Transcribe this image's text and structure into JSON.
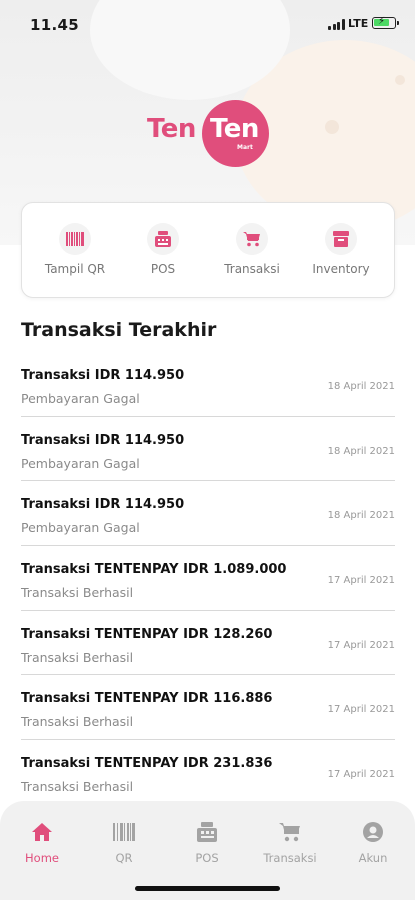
{
  "status_bar": {
    "time": "11.45",
    "network": "LTE",
    "battery_level": 0.7
  },
  "brand": {
    "word1": "Ten",
    "word2": "Ten",
    "sub": "Mart",
    "color": "#e04e7c"
  },
  "menu": [
    {
      "label": "Tampil QR",
      "icon": "barcode-icon"
    },
    {
      "label": "POS",
      "icon": "cash-register-icon"
    },
    {
      "label": "Transaksi",
      "icon": "cart-icon"
    },
    {
      "label": "Inventory",
      "icon": "box-icon"
    }
  ],
  "section_title": "Transaksi Terakhir",
  "transactions": [
    {
      "title": "Transaksi  IDR 114.950",
      "status": "Pembayaran Gagal",
      "date": "18 April 2021"
    },
    {
      "title": "Transaksi  IDR 114.950",
      "status": "Pembayaran Gagal",
      "date": "18 April 2021"
    },
    {
      "title": "Transaksi  IDR 114.950",
      "status": "Pembayaran Gagal",
      "date": "18 April 2021"
    },
    {
      "title": "Transaksi TENTENPAY IDR 1.089.000",
      "status": "Transaksi Berhasil",
      "date": "17 April 2021"
    },
    {
      "title": "Transaksi TENTENPAY IDR 128.260",
      "status": "Transaksi Berhasil",
      "date": "17 April 2021"
    },
    {
      "title": "Transaksi TENTENPAY IDR 116.886",
      "status": "Transaksi Berhasil",
      "date": "17 April 2021"
    },
    {
      "title": "Transaksi TENTENPAY IDR 231.836",
      "status": "Transaksi Berhasil",
      "date": "17 April 2021"
    }
  ],
  "nav": [
    {
      "label": "Home",
      "icon": "home-icon",
      "active": true
    },
    {
      "label": "QR",
      "icon": "barcode-icon",
      "active": false
    },
    {
      "label": "POS",
      "icon": "cash-register-icon",
      "active": false
    },
    {
      "label": "Transaksi",
      "icon": "cart-icon",
      "active": false
    },
    {
      "label": "Akun",
      "icon": "account-icon",
      "active": false
    }
  ],
  "colors": {
    "accent": "#e04e7c",
    "inactive": "#a3a3a3"
  }
}
